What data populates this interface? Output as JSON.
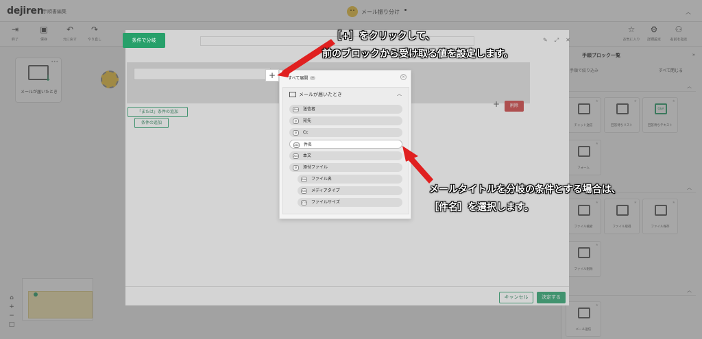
{
  "app": {
    "logo": "dejiren",
    "breadcrumb": "手順書編集",
    "flow_name": "メール振り分け"
  },
  "toolbar": {
    "items": [
      {
        "icon": "exit-icon",
        "label": "終了"
      },
      {
        "icon": "save-icon",
        "label": "保存"
      },
      {
        "icon": "undo-icon",
        "label": "元に戻す"
      },
      {
        "icon": "redo-icon",
        "label": "やり直し"
      }
    ],
    "right_items": [
      {
        "icon": "star-icon",
        "label": "お気に入り"
      },
      {
        "icon": "settings-icon",
        "label": "詳細設定"
      },
      {
        "icon": "nodes-icon",
        "label": "名前を指定"
      }
    ]
  },
  "canvas": {
    "node_label": "メールが届いたとき"
  },
  "sidebar": {
    "title": "手順ブロック一覧",
    "filter_label": "手順で絞り込み",
    "close_all": "すべて閉じる",
    "section_names": [
      "",
      "",
      ""
    ],
    "cards": [
      {
        "label": "チャット送信"
      },
      {
        "label": "回答待ちリスト"
      },
      {
        "label": "回答待ちテキスト",
        "badge": "Q&A"
      },
      {
        "label": "フォーム"
      },
      {
        "label": "ファイル検索"
      },
      {
        "label": "ファイル取得"
      },
      {
        "label": "ファイル保存"
      },
      {
        "label": "ファイル削除"
      },
      {
        "label": "メール送信"
      }
    ]
  },
  "modal": {
    "branch_tab": "条件で分岐",
    "add_condition": "条件の追加",
    "add_or_condition": "「または」条件の追加",
    "delete_button": "削除",
    "cancel_button": "キャンセル",
    "ok_button": "決定する"
  },
  "dropdown": {
    "expand_all": "すべて展開",
    "group_title": "メールが届いたとき",
    "items": [
      {
        "label": "送信者",
        "badge": "Abc",
        "indent": 0
      },
      {
        "label": "宛先",
        "badge": "@",
        "indent": 0
      },
      {
        "label": "Cc",
        "badge": "@",
        "indent": 0
      },
      {
        "label": "件名",
        "badge": "Abc",
        "indent": 0,
        "selected": true
      },
      {
        "label": "本文",
        "badge": "Abc",
        "indent": 0
      },
      {
        "label": "添付ファイル",
        "badge": "@",
        "indent": 0
      },
      {
        "label": "ファイル名",
        "badge": "Abc",
        "indent": 1
      },
      {
        "label": "メディアタイプ",
        "badge": "Abc",
        "indent": 1
      },
      {
        "label": "ファイルサイズ",
        "badge": "123",
        "indent": 1
      }
    ]
  },
  "annotations": {
    "top_line1": "［+］をクリックして、",
    "top_line2": "前のブロックから受け取る値を設定します。",
    "right_line1": "メールタイトルを分岐の条件とする場合は、",
    "right_line2": "［件名］を選択します。",
    "arrow_color": "#e02020"
  }
}
